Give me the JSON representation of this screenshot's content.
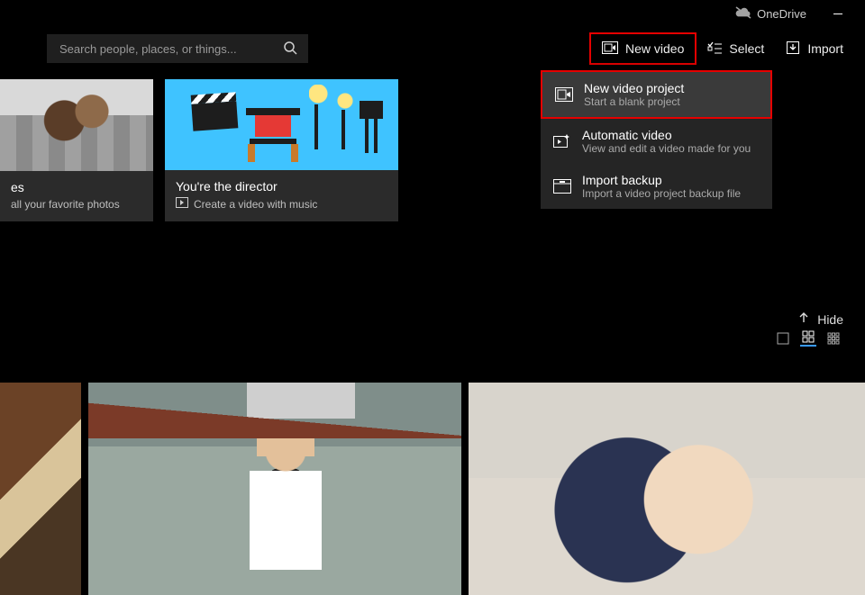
{
  "titlebar": {
    "onedrive_label": "OneDrive"
  },
  "toolbar": {
    "search_placeholder": "Search people, places, or things...",
    "new_video_label": "New video",
    "select_label": "Select",
    "import_label": "Import"
  },
  "cards": [
    {
      "title_suffix": "es",
      "subtitle": "all your favorite photos"
    },
    {
      "title": "You're the director",
      "subtitle": "Create a video with music"
    }
  ],
  "dropdown": {
    "items": [
      {
        "title": "New video project",
        "subtitle": "Start a blank project"
      },
      {
        "title": "Automatic video",
        "subtitle": "View and edit a video made for you"
      },
      {
        "title": "Import backup",
        "subtitle": "Import a video project backup file"
      }
    ]
  },
  "view": {
    "hide_label": "Hide"
  },
  "colors": {
    "highlight_red": "#e60000",
    "accent_blue": "#3a9bff"
  }
}
